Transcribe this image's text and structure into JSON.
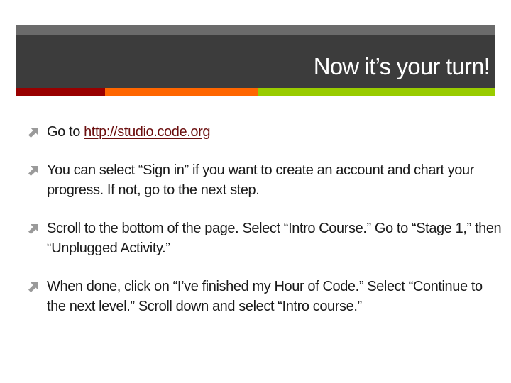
{
  "slide": {
    "title": "Now it’s your turn!",
    "colors": {
      "title_strip": "#6b6b6b",
      "title_background": "#3c3c3c",
      "title_text": "#ffffff",
      "accent_red": "#990000",
      "accent_orange": "#ff6600",
      "accent_green": "#99cc00",
      "bullet_icon": "#9a9a9a",
      "link": "#6b0f0f",
      "body_text": "#1a1a1a"
    },
    "bullets": [
      {
        "icon": "arrow-up-right-icon",
        "prefix": "Go to ",
        "link_text": "http://studio.code.org"
      },
      {
        "icon": "arrow-up-right-icon",
        "text": "You can select “Sign in” if you want to create an account and chart your progress.  If not, go to the next step."
      },
      {
        "icon": "arrow-up-right-icon",
        "text": "Scroll to the bottom of the page. Select “Intro Course.”  Go to “Stage 1,” then “Unplugged Activity.”"
      },
      {
        "icon": "arrow-up-right-icon",
        "text": "When done, click on “I’ve finished my Hour of Code.”  Select “Continue to the next level.”  Scroll down and select “Intro course.”"
      }
    ]
  }
}
